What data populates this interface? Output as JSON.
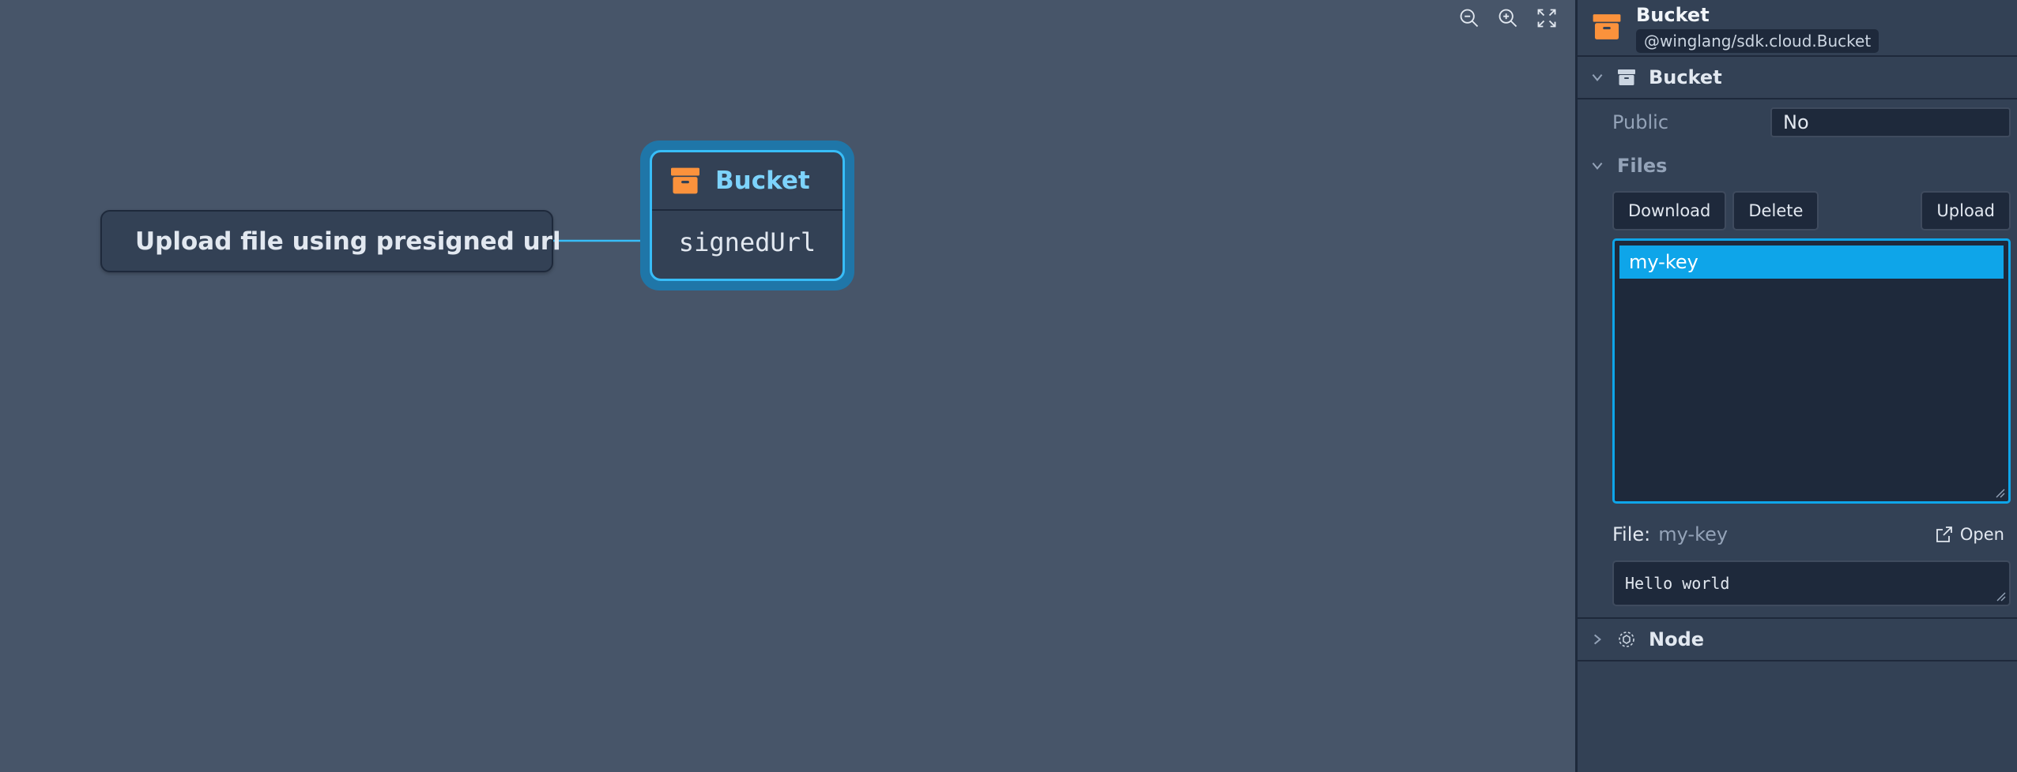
{
  "canvas": {
    "controls": {
      "zoom_out": "zoom-out-icon",
      "zoom_in": "zoom-in-icon",
      "fit": "fit-view-icon"
    },
    "trigger_node": {
      "label": "Upload file using presigned url",
      "icon": "bolt-icon"
    },
    "bucket_node": {
      "title": "Bucket",
      "port": "signedUrl",
      "icon": "archive-box-icon"
    }
  },
  "inspector": {
    "title": "Bucket",
    "type_badge": "@winglang/sdk.cloud.Bucket",
    "section_bucket": {
      "title": "Bucket"
    },
    "public": {
      "label": "Public",
      "value": "No"
    },
    "files": {
      "title": "Files",
      "download_label": "Download",
      "delete_label": "Delete",
      "upload_label": "Upload",
      "items": [
        "my-key"
      ],
      "file_label": "File:",
      "selected_file": "my-key",
      "open_label": "Open",
      "content": "Hello world"
    },
    "section_node": {
      "title": "Node"
    }
  },
  "colors": {
    "canvas_bg": "#475569",
    "panel_bg": "#334155",
    "accent": "#0ea5e9",
    "bucket_icon": "#fb923c",
    "bolt": "#38bdf8"
  }
}
